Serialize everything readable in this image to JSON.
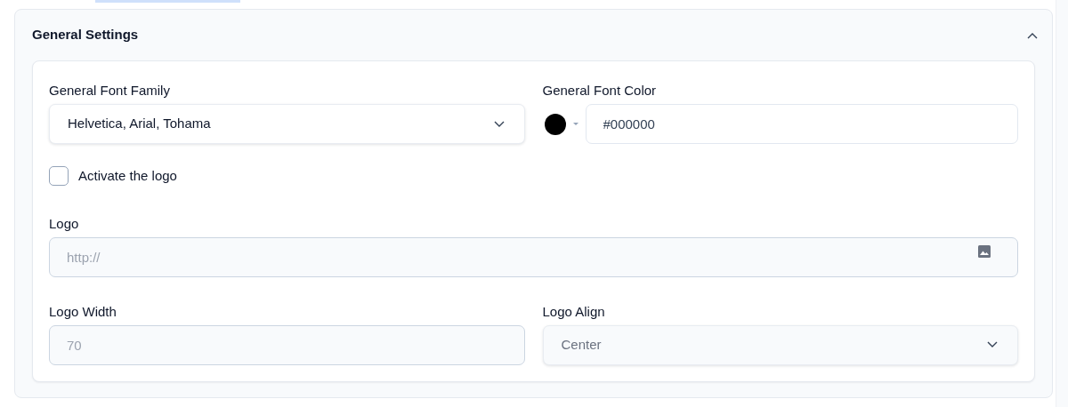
{
  "panel": {
    "title": "General Settings",
    "expanded": true
  },
  "font_family": {
    "label": "General Font Family",
    "value": "Helvetica, Arial, Tohama",
    "disabled": false
  },
  "font_color": {
    "label": "General Font Color",
    "color": "#000000",
    "value": "#000000"
  },
  "activate_logo": {
    "label": "Activate the logo",
    "checked": false
  },
  "logo": {
    "label": "Logo",
    "placeholder": "http://",
    "disabled": true
  },
  "logo_width": {
    "label": "Logo Width",
    "value": "70",
    "disabled": true
  },
  "logo_align": {
    "label": "Logo Align",
    "value": "Center",
    "disabled": true
  }
}
